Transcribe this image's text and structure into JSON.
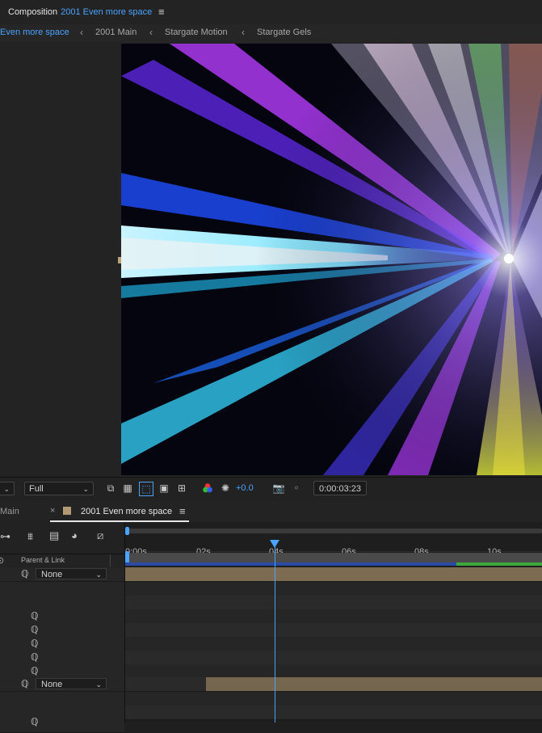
{
  "composition_panel": {
    "label": "Composition",
    "name": "2001 Even more space"
  },
  "breadcrumbs": [
    {
      "label": "Even more space",
      "active": true
    },
    {
      "label": "2001 Main"
    },
    {
      "label": "Stargate Motion"
    },
    {
      "label": "Stargate Gels"
    }
  ],
  "viewer_toolbar": {
    "resolution": "Full",
    "exposure": "+0.0",
    "timecode": "0:00:03:23"
  },
  "timeline": {
    "tabs": {
      "inactive": "Main",
      "active": "2001 Even more space",
      "tab_color": "#b39a72"
    },
    "column_header": "Parent & Link",
    "parent_values": [
      "None",
      "None"
    ],
    "ruler_labels": [
      "0:00s",
      "02s",
      "04s",
      "06s",
      "08s",
      "10s"
    ],
    "playhead_color": "#4aa3ff"
  },
  "colors": {
    "accent": "#4aa3ff",
    "layer_bar": "#7a6a50",
    "work_area": "#5a5a5a"
  }
}
